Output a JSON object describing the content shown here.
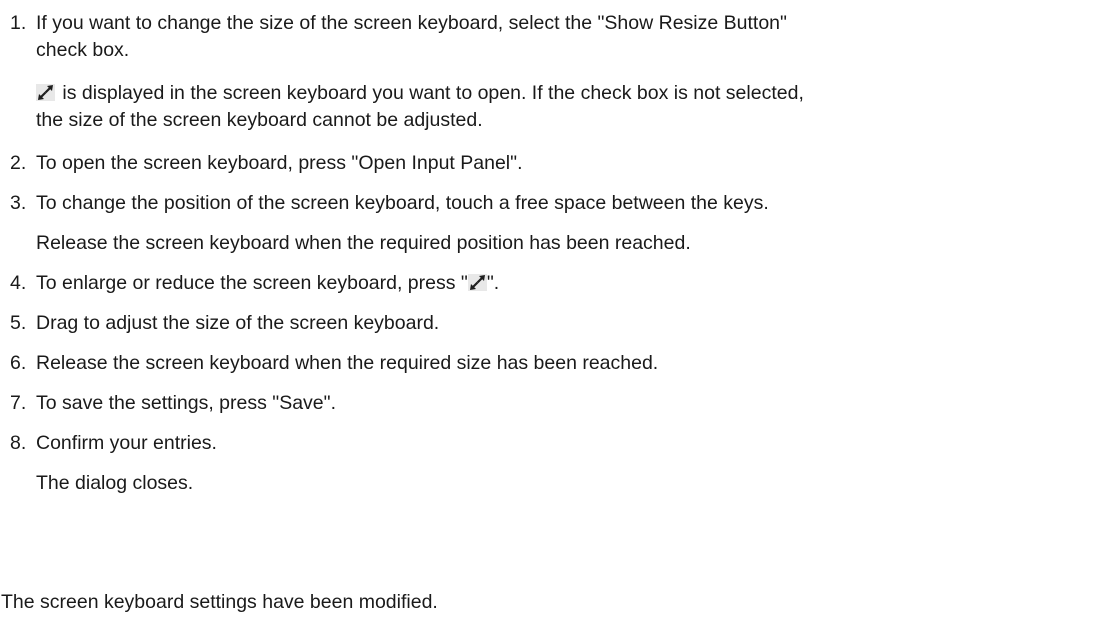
{
  "steps": [
    {
      "number": "1.",
      "line1": "If you want to change the size of the screen keyboard, select the \"Show Resize Button\"",
      "line2": "check box.",
      "note_line1": "is displayed in the screen keyboard you want to open. If the check box is not selected,",
      "note_line2": "the size of the screen keyboard cannot be adjusted.",
      "note_icon": "resize-arrows-icon"
    },
    {
      "number": "2.",
      "text": "To open the screen keyboard, press \"Open Input Panel\"."
    },
    {
      "number": "3.",
      "text": "To change the position of the screen keyboard, touch a free space between the keys.",
      "note": "Release the screen keyboard when the required position has been reached."
    },
    {
      "number": "4.",
      "text_before": "To enlarge or reduce the screen keyboard, press \"",
      "text_after": "\".",
      "icon": "resize-arrows-icon"
    },
    {
      "number": "5.",
      "text": "Drag to adjust the size of the screen keyboard."
    },
    {
      "number": "6.",
      "text": "Release the screen keyboard when the required size has been reached."
    },
    {
      "number": "7.",
      "text": "To save the settings, press \"Save\"."
    },
    {
      "number": "8.",
      "text": "Confirm your entries.",
      "note": "The dialog closes."
    }
  ],
  "conclusion": "The screen keyboard settings have been modified.",
  "colors": {
    "text": "#1a1a1a",
    "icon_arrow": "#1f1f1f",
    "icon_bg": "#e8e8e8"
  }
}
